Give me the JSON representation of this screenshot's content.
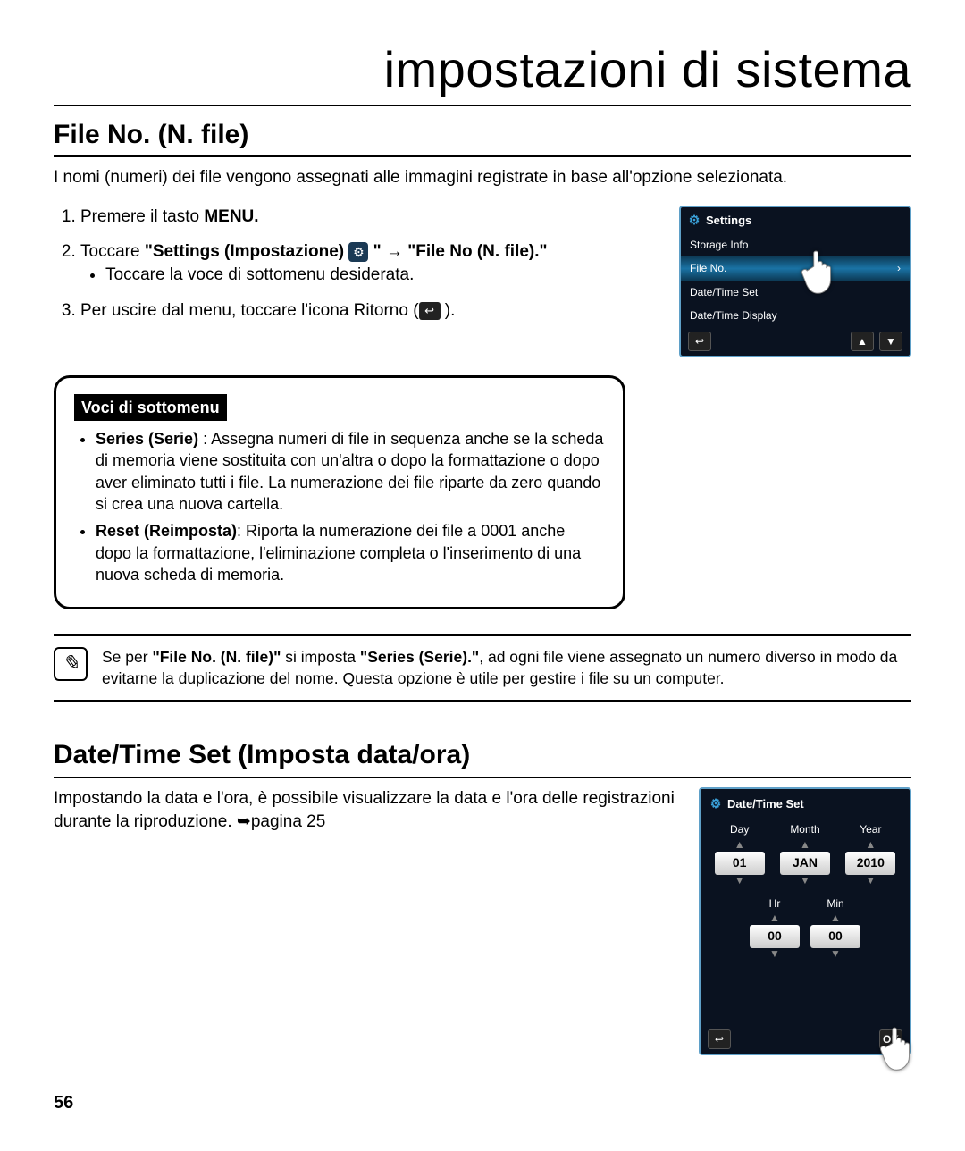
{
  "page_title": "impostazioni di sistema",
  "section1": {
    "heading": "File No. (N. file)",
    "lead": "I nomi (numeri) dei file vengono assegnati alle immagini registrate in base all'opzione selezionata.",
    "steps": {
      "s1_pre": "Premere il tasto ",
      "s1_bold": "MENU.",
      "s2_pre": "Toccare ",
      "s2_bold": "\"Settings (Impostazione) ",
      "s2_after_icon": " \" → \"File No (N. file).\"",
      "s2_sub": "Toccare la voce di sottomenu desiderata.",
      "s3_pre": "Per uscire dal menu, toccare l'icona Ritorno (",
      "s3_post": " )."
    }
  },
  "screen1": {
    "title": "Settings",
    "items": [
      "Storage Info",
      "File No.",
      "Date/Time Set",
      "Date/Time Display"
    ]
  },
  "submenu": {
    "label": "Voci di sottomenu",
    "series_name": "Series (Serie)",
    "series_text": " : Assegna numeri di file in sequenza anche se la scheda di memoria viene sostituita con un'altra o dopo la formattazione o dopo aver eliminato tutti i file. La numerazione dei file riparte da zero quando si crea una nuova cartella.",
    "reset_name": "Reset (Reimposta)",
    "reset_text": ": Riporta la numerazione dei file a 0001 anche dopo la formattazione, l'eliminazione completa o l'inserimento di una nuova scheda di memoria."
  },
  "note": {
    "pre": "Se per ",
    "b1": "\"File No. (N. file)\"",
    "mid": " si imposta ",
    "b2": "\"Series (Serie).\"",
    "post": ", ad ogni file viene assegnato un numero diverso in modo da evitarne la duplicazione del nome. Questa opzione è utile per gestire i file su un computer."
  },
  "section2": {
    "heading": "Date/Time Set (Imposta data/ora)",
    "lead": "Impostando la data e l'ora, è possibile visualizzare la data e l'ora delle registrazioni durante la riproduzione. ➥pagina 25"
  },
  "screen2": {
    "title": "Date/Time Set",
    "labels": {
      "day": "Day",
      "month": "Month",
      "year": "Year",
      "hr": "Hr",
      "min": "Min"
    },
    "values": {
      "day": "01",
      "month": "JAN",
      "year": "2010",
      "hr": "00",
      "min": "00"
    },
    "ok": "OK"
  },
  "page_num": "56"
}
